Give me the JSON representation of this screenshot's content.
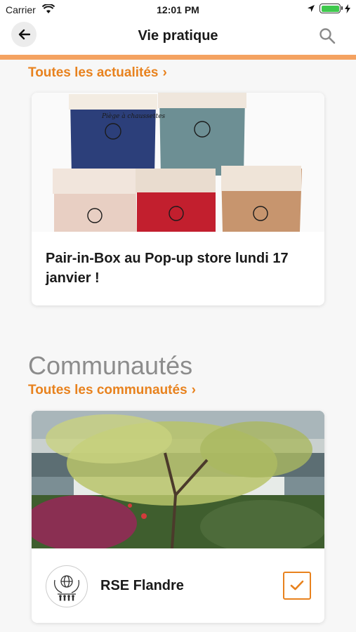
{
  "status_bar": {
    "carrier": "Carrier",
    "time": "12:01 PM",
    "battery_level": 1.0
  },
  "navbar": {
    "title": "Vie pratique",
    "back_icon": "arrow-left-icon",
    "search_icon": "search-icon"
  },
  "news": {
    "link_label": "Toutes les actualités",
    "chevron": "›",
    "card": {
      "title": "Pair-in-Box au Pop-up store lundi 17 janvier !",
      "image": "sock-basket-bags-photo",
      "bag_text": "Piège à chaussettes"
    }
  },
  "communities": {
    "heading": "Communautés",
    "link_label": "Toutes les communautés",
    "chevron": "›",
    "card": {
      "name": "RSE Flandre",
      "image": "garden-tree-photo",
      "avatar_icon": "globe-hands-icon",
      "checked": true,
      "check_icon": "checkmark-icon"
    }
  },
  "colors": {
    "accent": "#e8821e",
    "nav_rule": "#f4a261",
    "background": "#f7f7f7"
  }
}
